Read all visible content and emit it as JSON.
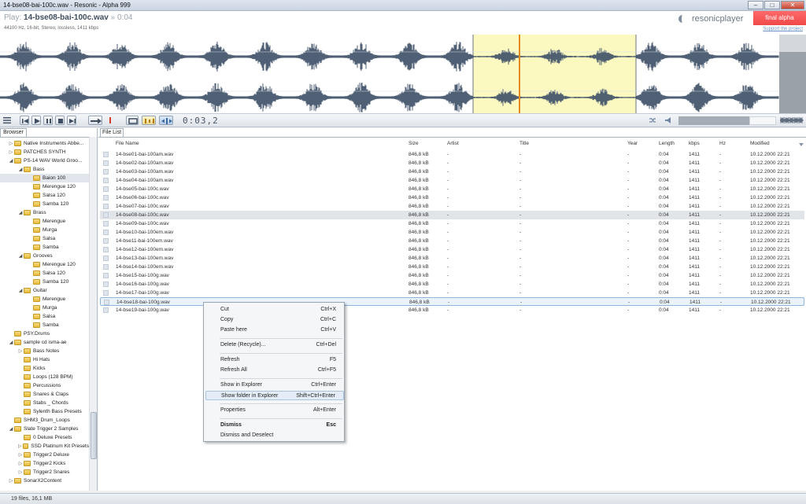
{
  "window": {
    "title": "14-bse08-bai-100c.wav - Resonic - Alpha 999"
  },
  "header": {
    "play_prefix": "Play:",
    "play_file": "14-bse08-bai-100c.wav",
    "play_duration": "» 0:04",
    "file_info": "44100 Hz, 16-bit, Stereo, lossless, 1411 kbps",
    "logo_text": "resonicplayer",
    "badge": "final alpha",
    "support_link": "Support the project"
  },
  "transport": {
    "timecode": "0:03,2"
  },
  "browser": {
    "tab_label": "Browser",
    "items": [
      {
        "label": "Native Instruments Abbe...",
        "indent": 1,
        "arrow": "▷"
      },
      {
        "label": "PATCHES SYNTH",
        "indent": 1,
        "arrow": "▷"
      },
      {
        "label": "PS-14 WAV World Groo...",
        "indent": 1,
        "arrow": "◢"
      },
      {
        "label": "Bass",
        "indent": 2,
        "arrow": "◢"
      },
      {
        "label": "Baion 100",
        "indent": 3,
        "arrow": "",
        "selected": true
      },
      {
        "label": "Merengue 120",
        "indent": 3,
        "arrow": ""
      },
      {
        "label": "Salsa 120",
        "indent": 3,
        "arrow": ""
      },
      {
        "label": "Samba 120",
        "indent": 3,
        "arrow": ""
      },
      {
        "label": "Brass",
        "indent": 2,
        "arrow": "◢"
      },
      {
        "label": "Merengue",
        "indent": 3,
        "arrow": ""
      },
      {
        "label": "Murga",
        "indent": 3,
        "arrow": ""
      },
      {
        "label": "Salsa",
        "indent": 3,
        "arrow": ""
      },
      {
        "label": "Samba",
        "indent": 3,
        "arrow": ""
      },
      {
        "label": "Grooves",
        "indent": 2,
        "arrow": "◢"
      },
      {
        "label": "Merengue 120",
        "indent": 3,
        "arrow": ""
      },
      {
        "label": "Salsa 120",
        "indent": 3,
        "arrow": ""
      },
      {
        "label": "Samba 120",
        "indent": 3,
        "arrow": ""
      },
      {
        "label": "Guitar",
        "indent": 2,
        "arrow": "◢"
      },
      {
        "label": "Merengue",
        "indent": 3,
        "arrow": ""
      },
      {
        "label": "Murga",
        "indent": 3,
        "arrow": ""
      },
      {
        "label": "Salsa",
        "indent": 3,
        "arrow": ""
      },
      {
        "label": "Samba",
        "indent": 3,
        "arrow": ""
      },
      {
        "label": "PSY.Drums",
        "indent": 1,
        "arrow": ""
      },
      {
        "label": "sample cd isma-ae",
        "indent": 1,
        "arrow": "◢"
      },
      {
        "label": "Bass Notes",
        "indent": 2,
        "arrow": "▷"
      },
      {
        "label": "Hi Hats",
        "indent": 2,
        "arrow": ""
      },
      {
        "label": "Kicks",
        "indent": 2,
        "arrow": ""
      },
      {
        "label": "Loops (128 BPM)",
        "indent": 2,
        "arrow": ""
      },
      {
        "label": "Percussions",
        "indent": 2,
        "arrow": ""
      },
      {
        "label": "Snares & Claps",
        "indent": 2,
        "arrow": ""
      },
      {
        "label": "Stabs _ Chords",
        "indent": 2,
        "arrow": ""
      },
      {
        "label": "Sylenth Bass Presets",
        "indent": 2,
        "arrow": ""
      },
      {
        "label": "SHM3_Drum_Loops",
        "indent": 1,
        "arrow": ""
      },
      {
        "label": "Slate Trigger 2 Samples",
        "indent": 1,
        "arrow": "◢"
      },
      {
        "label": "0 Deluxe Presets",
        "indent": 2,
        "arrow": ""
      },
      {
        "label": "SSD Platinum Kit Presets",
        "indent": 2,
        "arrow": "▷"
      },
      {
        "label": "Trigger2 Deluxe",
        "indent": 2,
        "arrow": "▷"
      },
      {
        "label": "Trigger2 Kicks",
        "indent": 2,
        "arrow": "▷"
      },
      {
        "label": "Trigger2 Snares",
        "indent": 2,
        "arrow": "▷"
      },
      {
        "label": "SonarX2Content",
        "indent": 1,
        "arrow": "▷"
      }
    ]
  },
  "filelist": {
    "tab_label": "File List",
    "columns": [
      "File Name",
      "Size",
      "Artist",
      "Title",
      "Year",
      "Length",
      "kbps",
      "Hz",
      "Modified"
    ],
    "rows": [
      [
        "14-bse01-bai-100am.wav",
        "846,8 kB",
        "-",
        "-",
        "-",
        "0:04",
        "1411",
        "-",
        "10.12.2000 22:21"
      ],
      [
        "14-bse02-bai-100am.wav",
        "846,8 kB",
        "-",
        "-",
        "-",
        "0:04",
        "1411",
        "-",
        "10.12.2000 22:21"
      ],
      [
        "14-bse03-bai-100am.wav",
        "846,8 kB",
        "-",
        "-",
        "-",
        "0:04",
        "1411",
        "-",
        "10.12.2000 22:21"
      ],
      [
        "14-bse04-bai-100am.wav",
        "846,8 kB",
        "-",
        "-",
        "-",
        "0:04",
        "1411",
        "-",
        "10.12.2000 22:21"
      ],
      [
        "14-bse05-bai-100c.wav",
        "846,8 kB",
        "-",
        "-",
        "-",
        "0:04",
        "1411",
        "-",
        "10.12.2000 22:21"
      ],
      [
        "14-bse06-bai-100c.wav",
        "846,8 kB",
        "-",
        "-",
        "-",
        "0:04",
        "1411",
        "-",
        "10.12.2000 22:21"
      ],
      [
        "14-bse07-bai-100c.wav",
        "846,8 kB",
        "-",
        "-",
        "-",
        "0:04",
        "1411",
        "-",
        "10.12.2000 22:21"
      ],
      [
        "14-bse08-bai-100c.wav",
        "846,8 kB",
        "-",
        "-",
        "-",
        "0:04",
        "1411",
        "-",
        "10.12.2000 22:21"
      ],
      [
        "14-bse09-bai-100c.wav",
        "846,8 kB",
        "-",
        "-",
        "-",
        "0:04",
        "1411",
        "-",
        "10.12.2000 22:21"
      ],
      [
        "14-bse10-bai-100em.wav",
        "846,8 kB",
        "-",
        "-",
        "-",
        "0:04",
        "1411",
        "-",
        "10.12.2000 22:21"
      ],
      [
        "14-bse11-bai-100em.wav",
        "846,8 kB",
        "-",
        "-",
        "-",
        "0:04",
        "1411",
        "-",
        "10.12.2000 22:21"
      ],
      [
        "14-bse12-bai-100em.wav",
        "846,8 kB",
        "-",
        "-",
        "-",
        "0:04",
        "1411",
        "-",
        "10.12.2000 22:21"
      ],
      [
        "14-bse13-bai-100em.wav",
        "846,8 kB",
        "-",
        "-",
        "-",
        "0:04",
        "1411",
        "-",
        "10.12.2000 22:21"
      ],
      [
        "14-bse14-bai-100em.wav",
        "846,8 kB",
        "-",
        "-",
        "-",
        "0:04",
        "1411",
        "-",
        "10.12.2000 22:21"
      ],
      [
        "14-bse15-bai-100g.wav",
        "846,8 kB",
        "-",
        "-",
        "-",
        "0:04",
        "1411",
        "-",
        "10.12.2000 22:21"
      ],
      [
        "14-bse16-bai-100g.wav",
        "846,8 kB",
        "-",
        "-",
        "-",
        "0:04",
        "1411",
        "-",
        "10.12.2000 22:21"
      ],
      [
        "14-bse17-bai-100g.wav",
        "846,8 kB",
        "-",
        "-",
        "-",
        "0:04",
        "1411",
        "-",
        "10.12.2000 22:21"
      ],
      [
        "14-bse18-bai-100g.wav",
        "846,8 kB",
        "-",
        "-",
        "-",
        "0:04",
        "1411",
        "-",
        "10.12.2000 22:21"
      ],
      [
        "14-bse19-bai-100g.wav",
        "846,8 kB",
        "-",
        "-",
        "-",
        "0:04",
        "1411",
        "-",
        "10.12.2000 22:21"
      ]
    ],
    "selected_row": 7,
    "focused_row": 17
  },
  "context_menu": {
    "items": [
      {
        "label": "Cut",
        "shortcut": "Ctrl+X"
      },
      {
        "label": "Copy",
        "shortcut": "Ctrl+C"
      },
      {
        "label": "Paste here",
        "shortcut": "Ctrl+V"
      },
      {
        "sep": true
      },
      {
        "label": "Delete (Recycle)...",
        "shortcut": "Ctrl+Del"
      },
      {
        "sep": true
      },
      {
        "label": "Refresh",
        "shortcut": "F5"
      },
      {
        "label": "Refresh All",
        "shortcut": "Ctrl+F5"
      },
      {
        "sep": true
      },
      {
        "label": "Show in Explorer",
        "shortcut": "Ctrl+Enter"
      },
      {
        "label": "Show folder in Explorer",
        "shortcut": "Shift+Ctrl+Enter",
        "hover": true
      },
      {
        "sep": true
      },
      {
        "label": "Properties",
        "shortcut": "Alt+Enter"
      },
      {
        "sep": true
      },
      {
        "label": "Dismiss",
        "shortcut": "Esc",
        "bold": true
      },
      {
        "label": "Dismiss and Deselect",
        "shortcut": ""
      }
    ]
  },
  "status": {
    "text": "19 files, 16,1 MB"
  },
  "colors": {
    "accent": "#f04848",
    "selection": "#fbf8c0",
    "playhead": "#e58a1a",
    "wave": "#3c4e66"
  }
}
